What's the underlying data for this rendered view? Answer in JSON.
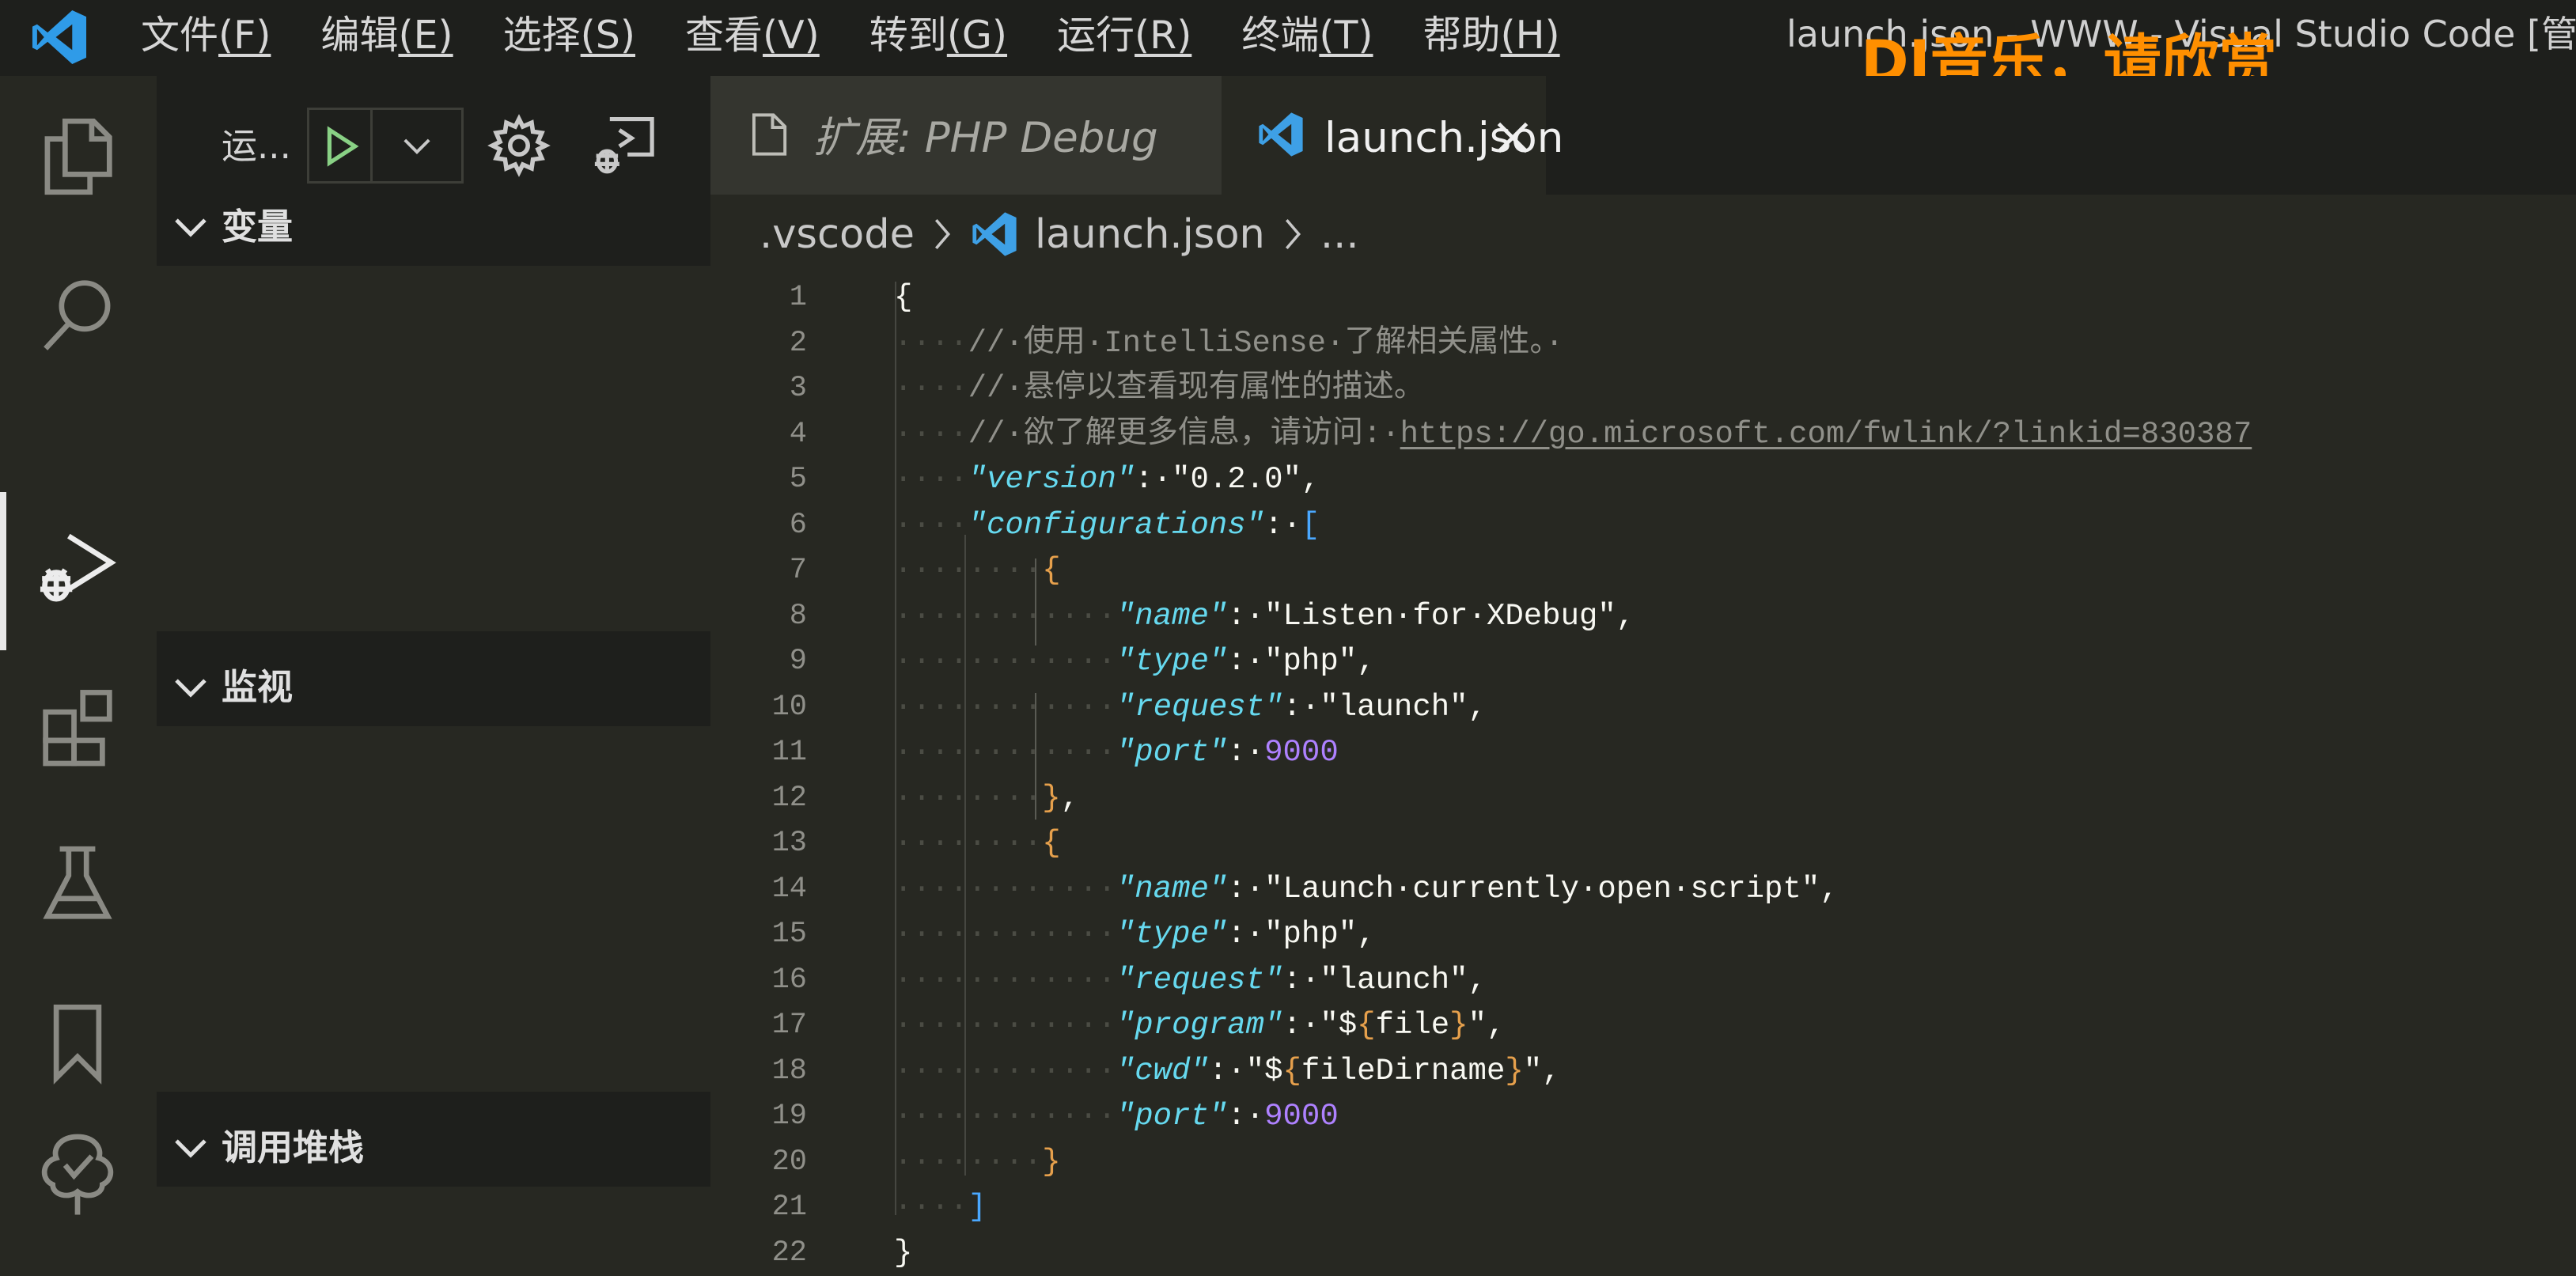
{
  "titlebar": {
    "menu": [
      {
        "label": "文件",
        "accel": "(F)"
      },
      {
        "label": "编辑",
        "accel": "(E)"
      },
      {
        "label": "选择",
        "accel": "(S)"
      },
      {
        "label": "查看",
        "accel": "(V)"
      },
      {
        "label": "转到",
        "accel": "(G)"
      },
      {
        "label": "运行",
        "accel": "(R)"
      },
      {
        "label": "终端",
        "accel": "(T)"
      },
      {
        "label": "帮助",
        "accel": "(H)"
      }
    ],
    "window_title": "launch.json - WWW - Visual Studio Code [管理",
    "watermark": "DJ音乐，请欣赏"
  },
  "activity_bar": {
    "icons": [
      "explorer-icon",
      "search-icon",
      "run-debug-icon",
      "extensions-icon",
      "testing-icon",
      "bookmarks-icon",
      "remote-icon"
    ],
    "active": "run-debug-icon"
  },
  "sidebar": {
    "run_label": "运...",
    "sections": [
      {
        "title": "变量"
      },
      {
        "title": "监视"
      },
      {
        "title": "调用堆栈"
      }
    ]
  },
  "tabs": [
    {
      "label": "扩展: PHP Debug",
      "active": false,
      "italic": true
    },
    {
      "label": "launch.json",
      "active": true
    }
  ],
  "breadcrumb": {
    "items": [
      ".vscode",
      "launch.json",
      "..."
    ]
  },
  "editor": {
    "lines": [
      {
        "n": "1",
        "tokens": [
          {
            "t": "{",
            "c": "tok-punct"
          }
        ]
      },
      {
        "n": "2",
        "tokens": [
          {
            "t": "····",
            "c": "tok-ws"
          },
          {
            "t": "//·使用·IntelliSense·了解相关属性。·",
            "c": "tok-comment"
          }
        ]
      },
      {
        "n": "3",
        "tokens": [
          {
            "t": "····",
            "c": "tok-ws"
          },
          {
            "t": "//·悬停以查看现有属性的描述。",
            "c": "tok-comment"
          }
        ]
      },
      {
        "n": "4",
        "tokens": [
          {
            "t": "····",
            "c": "tok-ws"
          },
          {
            "t": "//·欲了解更多信息，请访问:·",
            "c": "tok-comment"
          },
          {
            "t": "https://go.microsoft.com/fwlink/?linkid=830387",
            "c": "tok-link"
          }
        ]
      },
      {
        "n": "5",
        "tokens": [
          {
            "t": "····",
            "c": "tok-ws"
          },
          {
            "t": "\"version\"",
            "c": "tok-key"
          },
          {
            "t": ":·",
            "c": "tok-punct"
          },
          {
            "t": "\"0.2.0\"",
            "c": "tok-str-plain"
          },
          {
            "t": ",",
            "c": "tok-punct"
          }
        ]
      },
      {
        "n": "6",
        "tokens": [
          {
            "t": "····",
            "c": "tok-ws"
          },
          {
            "t": "\"configurations\"",
            "c": "tok-key"
          },
          {
            "t": ":·",
            "c": "tok-punct"
          },
          {
            "t": "[",
            "c": "tok-bracket"
          }
        ]
      },
      {
        "n": "7",
        "tokens": [
          {
            "t": "········",
            "c": "tok-ws"
          },
          {
            "t": "{",
            "c": "tok-brace"
          }
        ]
      },
      {
        "n": "8",
        "tokens": [
          {
            "t": "············",
            "c": "tok-ws"
          },
          {
            "t": "\"name\"",
            "c": "tok-key"
          },
          {
            "t": ":·",
            "c": "tok-punct"
          },
          {
            "t": "\"Listen·for·XDebug\"",
            "c": "tok-str-plain"
          },
          {
            "t": ",",
            "c": "tok-punct"
          }
        ]
      },
      {
        "n": "9",
        "tokens": [
          {
            "t": "············",
            "c": "tok-ws"
          },
          {
            "t": "\"type\"",
            "c": "tok-key"
          },
          {
            "t": ":·",
            "c": "tok-punct"
          },
          {
            "t": "\"php\"",
            "c": "tok-str-plain"
          },
          {
            "t": ",",
            "c": "tok-punct"
          }
        ]
      },
      {
        "n": "10",
        "tokens": [
          {
            "t": "············",
            "c": "tok-ws"
          },
          {
            "t": "\"request\"",
            "c": "tok-key"
          },
          {
            "t": ":·",
            "c": "tok-punct"
          },
          {
            "t": "\"launch\"",
            "c": "tok-str-plain"
          },
          {
            "t": ",",
            "c": "tok-punct"
          }
        ]
      },
      {
        "n": "11",
        "tokens": [
          {
            "t": "············",
            "c": "tok-ws"
          },
          {
            "t": "\"port\"",
            "c": "tok-key"
          },
          {
            "t": ":·",
            "c": "tok-punct"
          },
          {
            "t": "9000",
            "c": "tok-num"
          }
        ]
      },
      {
        "n": "12",
        "tokens": [
          {
            "t": "········",
            "c": "tok-ws"
          },
          {
            "t": "}",
            "c": "tok-brace"
          },
          {
            "t": ",",
            "c": "tok-punct"
          }
        ]
      },
      {
        "n": "13",
        "tokens": [
          {
            "t": "········",
            "c": "tok-ws"
          },
          {
            "t": "{",
            "c": "tok-brace"
          }
        ]
      },
      {
        "n": "14",
        "tokens": [
          {
            "t": "············",
            "c": "tok-ws"
          },
          {
            "t": "\"name\"",
            "c": "tok-key"
          },
          {
            "t": ":·",
            "c": "tok-punct"
          },
          {
            "t": "\"Launch·currently·open·script\"",
            "c": "tok-str-plain"
          },
          {
            "t": ",",
            "c": "tok-punct"
          }
        ]
      },
      {
        "n": "15",
        "tokens": [
          {
            "t": "············",
            "c": "tok-ws"
          },
          {
            "t": "\"type\"",
            "c": "tok-key"
          },
          {
            "t": ":·",
            "c": "tok-punct"
          },
          {
            "t": "\"php\"",
            "c": "tok-str-plain"
          },
          {
            "t": ",",
            "c": "tok-punct"
          }
        ]
      },
      {
        "n": "16",
        "tokens": [
          {
            "t": "············",
            "c": "tok-ws"
          },
          {
            "t": "\"request\"",
            "c": "tok-key"
          },
          {
            "t": ":·",
            "c": "tok-punct"
          },
          {
            "t": "\"launch\"",
            "c": "tok-str-plain"
          },
          {
            "t": ",",
            "c": "tok-punct"
          }
        ]
      },
      {
        "n": "17",
        "tokens": [
          {
            "t": "············",
            "c": "tok-ws"
          },
          {
            "t": "\"program\"",
            "c": "tok-key"
          },
          {
            "t": ":·",
            "c": "tok-punct"
          },
          {
            "t": "\"$",
            "c": "tok-str-plain"
          },
          {
            "t": "{",
            "c": "tok-brace"
          },
          {
            "t": "file",
            "c": "tok-str-plain"
          },
          {
            "t": "}",
            "c": "tok-brace"
          },
          {
            "t": "\",",
            "c": "tok-str-plain"
          }
        ]
      },
      {
        "n": "18",
        "tokens": [
          {
            "t": "············",
            "c": "tok-ws"
          },
          {
            "t": "\"cwd\"",
            "c": "tok-key"
          },
          {
            "t": ":·",
            "c": "tok-punct"
          },
          {
            "t": "\"$",
            "c": "tok-str-plain"
          },
          {
            "t": "{",
            "c": "tok-brace"
          },
          {
            "t": "fileDirname",
            "c": "tok-str-plain"
          },
          {
            "t": "}",
            "c": "tok-brace"
          },
          {
            "t": "\",",
            "c": "tok-str-plain"
          }
        ]
      },
      {
        "n": "19",
        "tokens": [
          {
            "t": "············",
            "c": "tok-ws"
          },
          {
            "t": "\"port\"",
            "c": "tok-key"
          },
          {
            "t": ":·",
            "c": "tok-punct"
          },
          {
            "t": "9000",
            "c": "tok-num"
          }
        ]
      },
      {
        "n": "20",
        "tokens": [
          {
            "t": "········",
            "c": "tok-ws"
          },
          {
            "t": "}",
            "c": "tok-brace"
          }
        ]
      },
      {
        "n": "21",
        "tokens": [
          {
            "t": "····",
            "c": "tok-ws"
          },
          {
            "t": "]",
            "c": "tok-bracket"
          }
        ]
      },
      {
        "n": "22",
        "tokens": [
          {
            "t": "}",
            "c": "tok-punct"
          }
        ]
      }
    ]
  },
  "colors": {
    "titlebar_bg": "#1e1f1c",
    "editor_bg": "#272822",
    "sidebar_bg": "#1e1f1c",
    "accent_blue": "#3ea0e6",
    "run_green": "#89d185",
    "watermark": "#ff8f00"
  }
}
